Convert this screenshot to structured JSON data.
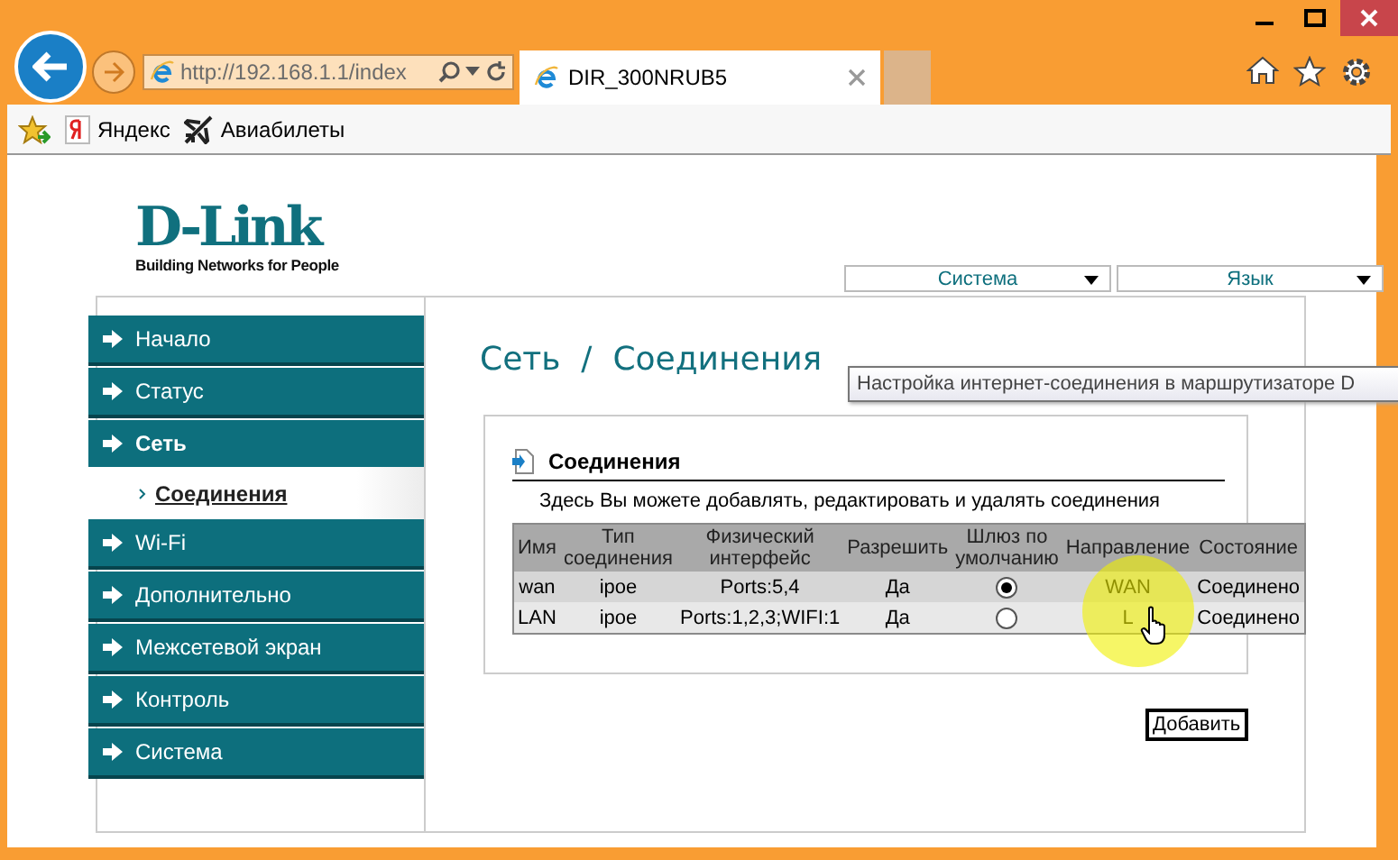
{
  "browser": {
    "address": "http://192.168.1.1/index",
    "tabs": [
      {
        "label": "DIR_300NRUB5",
        "selected": true
      }
    ],
    "favorites": [
      {
        "label": "Яндекс",
        "kind": "yandex"
      },
      {
        "label": "Авиабилеты",
        "kind": "plane"
      }
    ]
  },
  "logo": {
    "brand": "D-Link",
    "tagline": "Building Networks for People"
  },
  "top_menus": [
    {
      "label": "Система"
    },
    {
      "label": "Язык"
    }
  ],
  "sidebar": {
    "items": [
      {
        "label": "Начало",
        "expanded": false
      },
      {
        "label": "Статус",
        "expanded": false
      },
      {
        "label": "Сеть",
        "expanded": true,
        "children": [
          {
            "label": "Соединения",
            "selected": true
          }
        ]
      },
      {
        "label": "Wi-Fi",
        "expanded": false
      },
      {
        "label": "Дополнительно",
        "expanded": false
      },
      {
        "label": "Межсетевой экран",
        "expanded": false
      },
      {
        "label": "Контроль",
        "expanded": false
      },
      {
        "label": "Система",
        "expanded": false
      }
    ]
  },
  "page_title": "Сеть  /  Соединения",
  "tooltip": "Настройка интернет-соединения в маршрутизаторе D",
  "section": {
    "title": "Соединения",
    "description": "Здесь Вы можете добавлять, редактировать и удалять соединения"
  },
  "table": {
    "columns": [
      "Имя",
      "Тип соединения",
      "Физический интерфейс",
      "Разрешить",
      "Шлюз по умолчанию",
      "Направление",
      "Состояние"
    ],
    "rows": [
      {
        "name": "wan",
        "type": "ipoe",
        "interface": "Ports:5,4",
        "enabled": "Да",
        "default_gateway": true,
        "direction": "WAN",
        "status": "Соединено"
      },
      {
        "name": "LAN",
        "type": "ipoe",
        "interface": "Ports:1,2,3;WIFI:1",
        "enabled": "Да",
        "default_gateway": false,
        "direction": "L",
        "status": "Соединено"
      }
    ]
  },
  "add_button": "Добавить"
}
